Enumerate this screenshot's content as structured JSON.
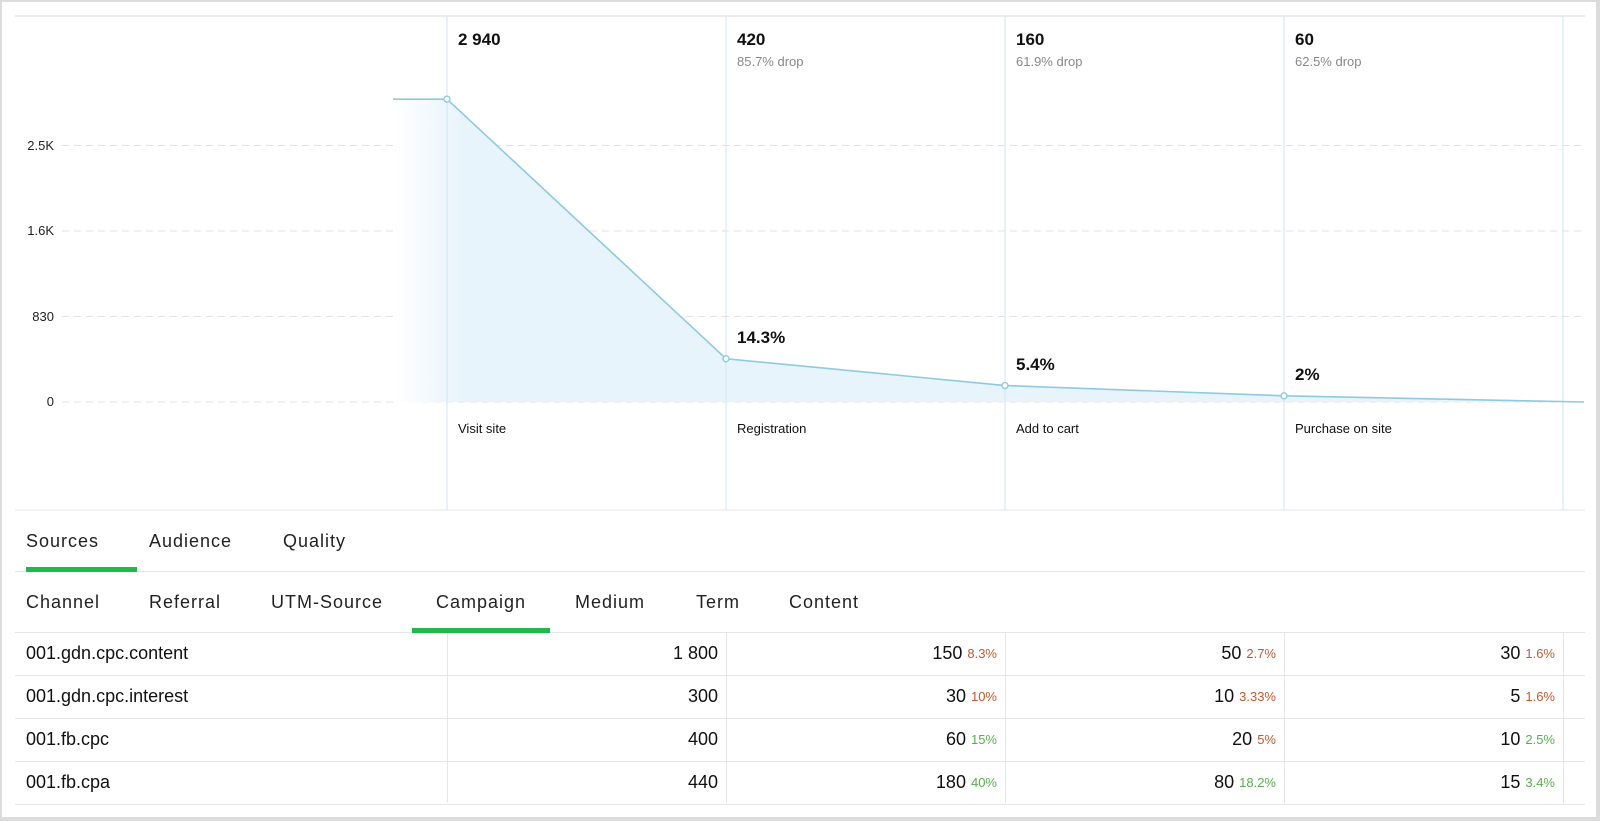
{
  "chart_data": {
    "type": "area",
    "title": "",
    "xlabel": "",
    "ylabel": "",
    "ylim": [
      0,
      3320
    ],
    "grid": true,
    "y_ticks": [
      {
        "value": 0,
        "label": "0"
      },
      {
        "value": 830,
        "label": "830"
      },
      {
        "value": 1660,
        "label": "1.6K"
      },
      {
        "value": 2490,
        "label": "2.5K"
      }
    ],
    "categories": [
      "Visit site",
      "Registration",
      "Add to cart",
      "Purchase on site"
    ],
    "values": [
      2940,
      420,
      160,
      60
    ],
    "count_labels": [
      "2 940",
      "420",
      "160",
      "60"
    ],
    "drop_labels": [
      "",
      "85.7% drop",
      "61.9% drop",
      "62.5% drop"
    ],
    "conversion_labels": [
      "",
      "14.3%",
      "5.4%",
      "2%"
    ],
    "colors": {
      "line": "#8ec9e4",
      "fill": "#e8f4fc",
      "grid": "#e2e2e2",
      "column": "#d4e8f4"
    }
  },
  "tabs": {
    "main": [
      {
        "label": "Sources",
        "active": true
      },
      {
        "label": "Audience",
        "active": false
      },
      {
        "label": "Quality",
        "active": false
      }
    ],
    "sub": [
      {
        "label": "Channel",
        "active": false
      },
      {
        "label": "Referral",
        "active": false
      },
      {
        "label": "UTM-Source",
        "active": false
      },
      {
        "label": "Campaign",
        "active": true
      },
      {
        "label": "Medium",
        "active": false
      },
      {
        "label": "Term",
        "active": false
      },
      {
        "label": "Content",
        "active": false
      }
    ]
  },
  "table": {
    "rows": [
      {
        "name": "001.gdn.cpc.content",
        "cells": [
          {
            "value": "1 800",
            "pct": "",
            "trend": ""
          },
          {
            "value": "150",
            "pct": "8.3%",
            "trend": "neg"
          },
          {
            "value": "50",
            "pct": "2.7%",
            "trend": "neg"
          },
          {
            "value": "30",
            "pct": "1.6%",
            "trend": "neg"
          }
        ]
      },
      {
        "name": "001.gdn.cpc.interest",
        "cells": [
          {
            "value": "300",
            "pct": "",
            "trend": ""
          },
          {
            "value": "30",
            "pct": "10%",
            "trend": "neg"
          },
          {
            "value": "10",
            "pct": "3.33%",
            "trend": "neg"
          },
          {
            "value": "5",
            "pct": "1.6%",
            "trend": "neg"
          }
        ]
      },
      {
        "name": "001.fb.cpc",
        "cells": [
          {
            "value": "400",
            "pct": "",
            "trend": ""
          },
          {
            "value": "60",
            "pct": "15%",
            "trend": "pos"
          },
          {
            "value": "20",
            "pct": "5%",
            "trend": "neg"
          },
          {
            "value": "10",
            "pct": "2.5%",
            "trend": "pos"
          }
        ]
      },
      {
        "name": "001.fb.cpa",
        "cells": [
          {
            "value": "440",
            "pct": "",
            "trend": ""
          },
          {
            "value": "180",
            "pct": "40%",
            "trend": "pos"
          },
          {
            "value": "80",
            "pct": "18.2%",
            "trend": "pos"
          },
          {
            "value": "15",
            "pct": "3.4%",
            "trend": "pos"
          }
        ]
      }
    ]
  }
}
